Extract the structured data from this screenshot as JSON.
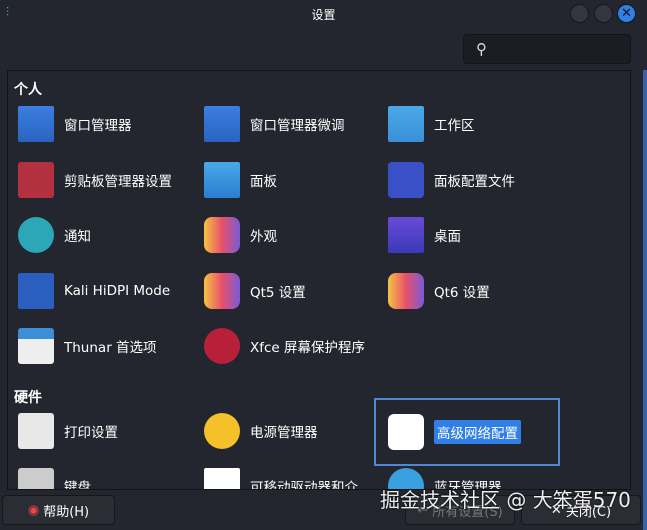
{
  "window": {
    "title": "设置"
  },
  "search": {
    "placeholder": ""
  },
  "sections": [
    {
      "title": "个人",
      "items": [
        "窗口管理器",
        "窗口管理器微调",
        "工作区",
        "剪贴板管理器设置",
        "面板",
        "面板配置文件",
        "通知",
        "外观",
        "桌面",
        "Kali HiDPI Mode",
        "Qt5 设置",
        "Qt6 设置",
        "Thunar 首选项",
        "Xfce 屏幕保护程序"
      ]
    },
    {
      "title": "硬件",
      "items": [
        "打印设置",
        "电源管理器",
        "高级网络配置",
        "键盘",
        "可移动驱动器和介",
        "蓝牙管理器"
      ]
    }
  ],
  "buttons": {
    "help": "帮助(H)",
    "all_settings": "所有设置(S)",
    "close": "关闭(C)"
  },
  "watermark": "掘金技术社区 @ 大笨蛋570"
}
